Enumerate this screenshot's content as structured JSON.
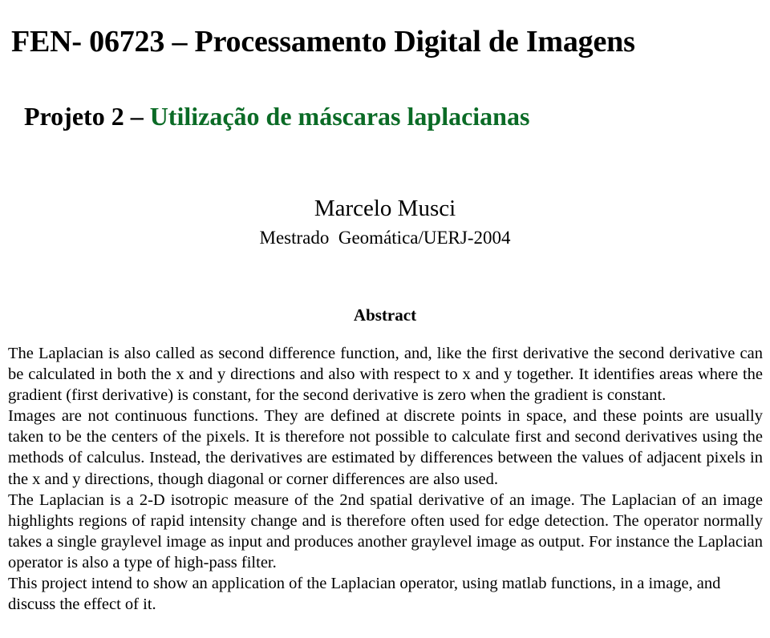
{
  "document": {
    "title": "FEN- 06723 – Processamento Digital de Imagens",
    "subtitle_prefix": "Projeto 2 – ",
    "subtitle_accent": "Utilização de máscaras laplacianas",
    "subtitle_accent_color": "#0b6b26",
    "author": {
      "name": "Marcelo Musci",
      "affiliation": "Mestrado  Geomática/UERJ-2004"
    },
    "abstract": {
      "heading": "Abstract",
      "paragraphs": [
        "The Laplacian is also called as second difference function, and, like the first derivative the second derivative can be calculated in both the x and y directions and also with respect to x and y together. It identifies areas where the gradient (first derivative) is constant, for the second derivative is zero when the gradient is constant.",
        "Images are not continuous functions. They are defined at discrete points in space, and these points are usually taken to be the centers of the pixels. It is therefore not possible to calculate first and second derivatives using the methods of calculus. Instead, the derivatives are estimated by differences between the values of adjacent pixels in the x and y directions, though diagonal or corner differences are also used.",
        "The Laplacian is a 2-D isotropic measure of the 2nd spatial derivative of an image. The Laplacian of an image highlights regions of rapid intensity change and is therefore often used for edge detection. The operator normally takes a single graylevel image as input and produces another graylevel image as output. For instance the Laplacian operator is also a type of high-pass filter.",
        "This project intend to show an application of the Laplacian operator, using matlab functions, in a image, and discuss the effect of it."
      ]
    }
  }
}
